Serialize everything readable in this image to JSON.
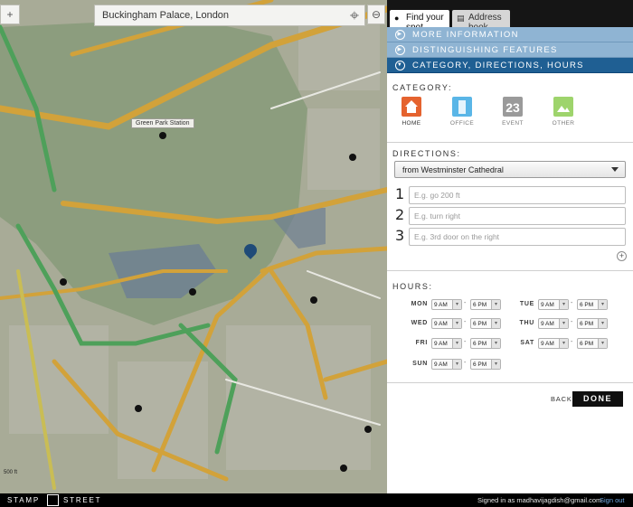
{
  "map": {
    "search_value": "Buckingham Palace, London",
    "crosshair_icon": "crosshair-icon",
    "station_label": "Green Park Station",
    "scale_text": "500 ft"
  },
  "tabs": [
    {
      "label": "Find your spot",
      "icon": "location-icon"
    },
    {
      "label": "Address book",
      "icon": "book-icon"
    }
  ],
  "accordion": [
    {
      "label": "MORE INFORMATION",
      "icon": "chevron-right-icon"
    },
    {
      "label": "DISTINGUISHING FEATURES",
      "icon": "chevron-right-icon"
    },
    {
      "label": "CATEGORY, DIRECTIONS, HOURS",
      "icon": "chevron-down-icon"
    }
  ],
  "category": {
    "heading": "CATEGORY:",
    "items": [
      {
        "label": "HOME",
        "color": "#e5632f"
      },
      {
        "label": "OFFICE",
        "color": "#5ab6e7"
      },
      {
        "label": "EVENT",
        "badge": "23",
        "color": "#9a9a9a"
      },
      {
        "label": "OTHER",
        "color": "#9ed46c"
      }
    ]
  },
  "directions": {
    "heading": "DIRECTIONS:",
    "from_value": "from Westminster Cathedral",
    "steps": [
      {
        "num": "1",
        "placeholder": "E.g. go 200 ft"
      },
      {
        "num": "2",
        "placeholder": "E.g. turn right"
      },
      {
        "num": "3",
        "placeholder": "E.g. 3rd door on the right"
      }
    ]
  },
  "hours": {
    "heading": "HOURS:",
    "separator": "-",
    "days": [
      {
        "day": "MON",
        "open": "9 AM",
        "close": "6 PM"
      },
      {
        "day": "TUE",
        "open": "9 AM",
        "close": "6 PM"
      },
      {
        "day": "WED",
        "open": "9 AM",
        "close": "6 PM"
      },
      {
        "day": "THU",
        "open": "9 AM",
        "close": "6 PM"
      },
      {
        "day": "FRI",
        "open": "9 AM",
        "close": "6 PM"
      },
      {
        "day": "SAT",
        "open": "9 AM",
        "close": "6 PM"
      },
      {
        "day": "SUN",
        "open": "9 AM",
        "close": "6 PM"
      }
    ]
  },
  "actions": {
    "back": "BACK",
    "done": "DONE"
  },
  "footer": {
    "brand_left": "STAMP",
    "brand_right": "STREET",
    "signed_in": "Signed in as madhavijagdish@gmail.com",
    "sign_out": "Sign out"
  }
}
